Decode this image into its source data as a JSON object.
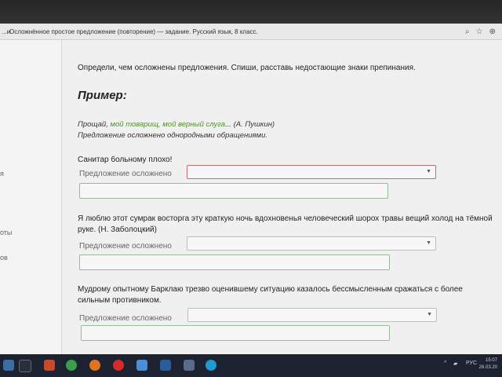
{
  "browser": {
    "tab_prefix": "...и",
    "title": "Осложнённое простое предложение (повторение) — задание. Русский язык, 8 класс.",
    "controls": [
      "⌕",
      "☆",
      "⊕"
    ]
  },
  "left_pane": {
    "fragments": [
      "я",
      "оты",
      "ов"
    ]
  },
  "task": {
    "instruction": "Определи, чем осложнены предложения. Спиши, расставь недостающие знаки препинания.",
    "example_heading": "Пример:",
    "example_prefix": "Прощай, ",
    "example_highlight": "мой товарищ, мой верный слуга",
    "example_suffix": "... (А. Пушкин)",
    "example_explanation": "Предложение осложнено однородными обращениями."
  },
  "questions": [
    {
      "text": "Санитар больному плохо!",
      "label": "Предложение осложнено",
      "select_value": "",
      "answer": ""
    },
    {
      "text": "Я люблю этот сумрак восторга эту краткую ночь вдохновенья человеческий шорох травы вещий холод на тёмной руке. (Н. Заболоцкий)",
      "label": "Предложение осложнено",
      "select_value": "",
      "answer": ""
    },
    {
      "text": "Мудрому опытному Барклаю трезво оценившему ситуацию казалось бессмысленным сражаться с более сильным противником.",
      "label": "Предложение осложнено",
      "select_value": "",
      "answer": ""
    }
  ],
  "taskbar": {
    "language": "РУС",
    "time": "15:07",
    "date": "26.03.20"
  },
  "colors": {
    "highlight_green": "#4f8f2f",
    "error_border": "#c96b6b",
    "answer_border": "#9ab89a"
  }
}
